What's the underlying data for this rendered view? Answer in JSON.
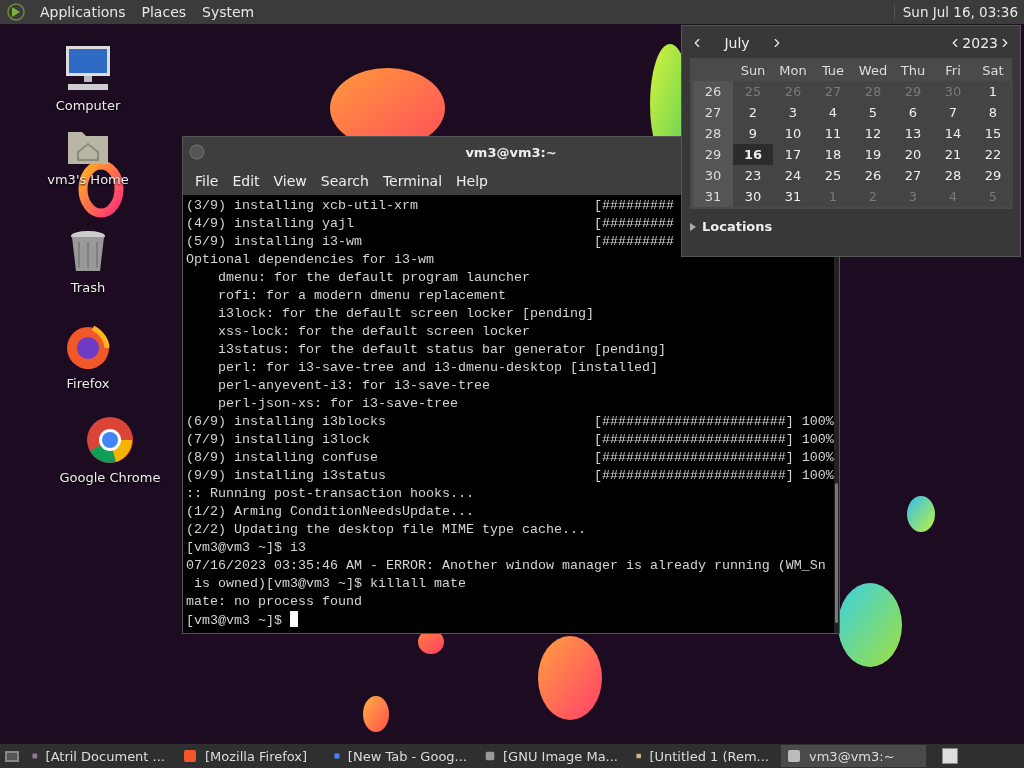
{
  "top_panel": {
    "menus": [
      {
        "label": "Applications"
      },
      {
        "label": "Places"
      },
      {
        "label": "System"
      }
    ],
    "clock": "Sun Jul 16, 03:36"
  },
  "desktop_icons": [
    {
      "label": "Computer"
    },
    {
      "label": "vm3's Home"
    },
    {
      "label": "Trash"
    },
    {
      "label": "Firefox"
    },
    {
      "label": "Google Chrome"
    }
  ],
  "terminal": {
    "title": "vm3@vm3:~",
    "menus": [
      "File",
      "Edit",
      "View",
      "Search",
      "Terminal",
      "Help"
    ],
    "lines": [
      "(3/9) installing xcb-util-xrm                      [#########",
      "(4/9) installing yajl                              [#########",
      "(5/9) installing i3-wm                             [#########",
      "Optional dependencies for i3-wm",
      "    dmenu: for the default program launcher",
      "    rofi: for a modern dmenu replacement",
      "    i3lock: for the default screen locker [pending]",
      "    xss-lock: for the default screen locker",
      "    i3status: for the default status bar generator [pending]",
      "    perl: for i3-save-tree and i3-dmenu-desktop [installed]",
      "    perl-anyevent-i3: for i3-save-tree",
      "    perl-json-xs: for i3-save-tree",
      "(6/9) installing i3blocks                          [#######################] 100%",
      "(7/9) installing i3lock                            [#######################] 100%",
      "(8/9) installing confuse                           [#######################] 100%",
      "(9/9) installing i3status                          [#######################] 100%",
      ":: Running post-transaction hooks...",
      "(1/2) Arming ConditionNeedsUpdate...",
      "(2/2) Updating the desktop file MIME type cache...",
      "[vm3@vm3 ~]$ i3",
      "07/16/2023 03:35:46 AM - ERROR: Another window manager is already running (WM_Sn",
      " is owned)[vm3@vm3 ~]$ killall mate",
      "mate: no process found"
    ],
    "prompt": "[vm3@vm3 ~]$ "
  },
  "calendar": {
    "month": "July",
    "year": "2023",
    "weekdays": [
      "Sun",
      "Mon",
      "Tue",
      "Wed",
      "Thu",
      "Fri",
      "Sat"
    ],
    "weeks": [
      {
        "week": "26",
        "days": [
          {
            "day": "25",
            "other_month": true,
            "selected": false
          },
          {
            "day": "26",
            "other_month": true,
            "selected": false
          },
          {
            "day": "27",
            "other_month": true,
            "selected": false
          },
          {
            "day": "28",
            "other_month": true,
            "selected": false
          },
          {
            "day": "29",
            "other_month": true,
            "selected": false
          },
          {
            "day": "30",
            "other_month": true,
            "selected": false
          },
          {
            "day": "1",
            "other_month": false,
            "selected": false
          }
        ]
      },
      {
        "week": "27",
        "days": [
          {
            "day": "2",
            "other_month": false,
            "selected": false
          },
          {
            "day": "3",
            "other_month": false,
            "selected": false
          },
          {
            "day": "4",
            "other_month": false,
            "selected": false
          },
          {
            "day": "5",
            "other_month": false,
            "selected": false
          },
          {
            "day": "6",
            "other_month": false,
            "selected": false
          },
          {
            "day": "7",
            "other_month": false,
            "selected": false
          },
          {
            "day": "8",
            "other_month": false,
            "selected": false
          }
        ]
      },
      {
        "week": "28",
        "days": [
          {
            "day": "9",
            "other_month": false,
            "selected": false
          },
          {
            "day": "10",
            "other_month": false,
            "selected": false
          },
          {
            "day": "11",
            "other_month": false,
            "selected": false
          },
          {
            "day": "12",
            "other_month": false,
            "selected": false
          },
          {
            "day": "13",
            "other_month": false,
            "selected": false
          },
          {
            "day": "14",
            "other_month": false,
            "selected": false
          },
          {
            "day": "15",
            "other_month": false,
            "selected": false
          }
        ]
      },
      {
        "week": "29",
        "days": [
          {
            "day": "16",
            "other_month": false,
            "selected": true
          },
          {
            "day": "17",
            "other_month": false,
            "selected": false
          },
          {
            "day": "18",
            "other_month": false,
            "selected": false
          },
          {
            "day": "19",
            "other_month": false,
            "selected": false
          },
          {
            "day": "20",
            "other_month": false,
            "selected": false
          },
          {
            "day": "21",
            "other_month": false,
            "selected": false
          },
          {
            "day": "22",
            "other_month": false,
            "selected": false
          }
        ]
      },
      {
        "week": "30",
        "days": [
          {
            "day": "23",
            "other_month": false,
            "selected": false
          },
          {
            "day": "24",
            "other_month": false,
            "selected": false
          },
          {
            "day": "25",
            "other_month": false,
            "selected": false
          },
          {
            "day": "26",
            "other_month": false,
            "selected": false
          },
          {
            "day": "27",
            "other_month": false,
            "selected": false
          },
          {
            "day": "28",
            "other_month": false,
            "selected": false
          },
          {
            "day": "29",
            "other_month": false,
            "selected": false
          }
        ]
      },
      {
        "week": "31",
        "days": [
          {
            "day": "30",
            "other_month": false,
            "selected": false
          },
          {
            "day": "31",
            "other_month": false,
            "selected": false
          },
          {
            "day": "1",
            "other_month": true,
            "selected": false
          },
          {
            "day": "2",
            "other_month": true,
            "selected": false
          },
          {
            "day": "3",
            "other_month": true,
            "selected": false
          },
          {
            "day": "4",
            "other_month": true,
            "selected": false
          },
          {
            "day": "5",
            "other_month": true,
            "selected": false
          }
        ]
      }
    ],
    "locations": {
      "label": "Locations",
      "expanded": false
    }
  },
  "taskbar": {
    "items": [
      {
        "label": "[Atril Document ...",
        "selected": false
      },
      {
        "label": "[Mozilla Firefox]",
        "selected": false
      },
      {
        "label": "[New Tab - Goog...",
        "selected": false
      },
      {
        "label": "[GNU Image Ma...",
        "selected": false
      },
      {
        "label": "[Untitled 1 (Rem...",
        "selected": false
      },
      {
        "label": "vm3@vm3:~",
        "selected": true
      }
    ]
  }
}
